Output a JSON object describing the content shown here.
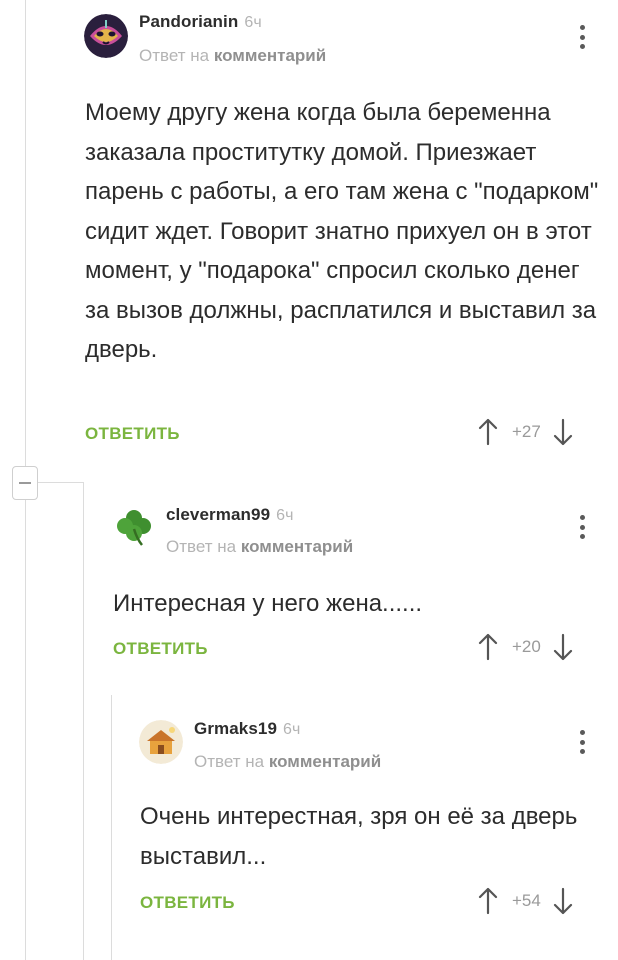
{
  "comments": [
    {
      "author": "Pandorianin",
      "time": "6ч",
      "reply_prefix": "Ответ на",
      "reply_target": "комментарий",
      "text": "Моему другу жена когда была беременна заказала проститутку домой. Приезжает парень с работы, а его там жена с \"подарком\" сидит ждет. Говорит знатно прихуел он в этот момент,  у \"подарока\" спросил сколько денег за вызов должны, расплатился и выставил за дверь.",
      "reply_label": "ОТВЕТИТЬ",
      "score": "+27",
      "avatar_icon": "mask-avatar"
    },
    {
      "author": "cleverman99",
      "time": "6ч",
      "reply_prefix": "Ответ на",
      "reply_target": "комментарий",
      "text": "Интересная у него жена......",
      "reply_label": "ОТВЕТИТЬ",
      "score": "+20",
      "avatar_icon": "clover-avatar"
    },
    {
      "author": "Grmaks19",
      "time": "6ч",
      "reply_prefix": "Ответ на",
      "reply_target": "комментарий",
      "text": "Очень интерестная, зря он её за дверь выставил...",
      "reply_label": "ОТВЕТИТЬ",
      "score": "+54",
      "avatar_icon": "house-avatar"
    }
  ],
  "colors": {
    "accent": "#7bb53f",
    "muted": "#b4b4b4",
    "thread_line": "#dcdcdc"
  }
}
